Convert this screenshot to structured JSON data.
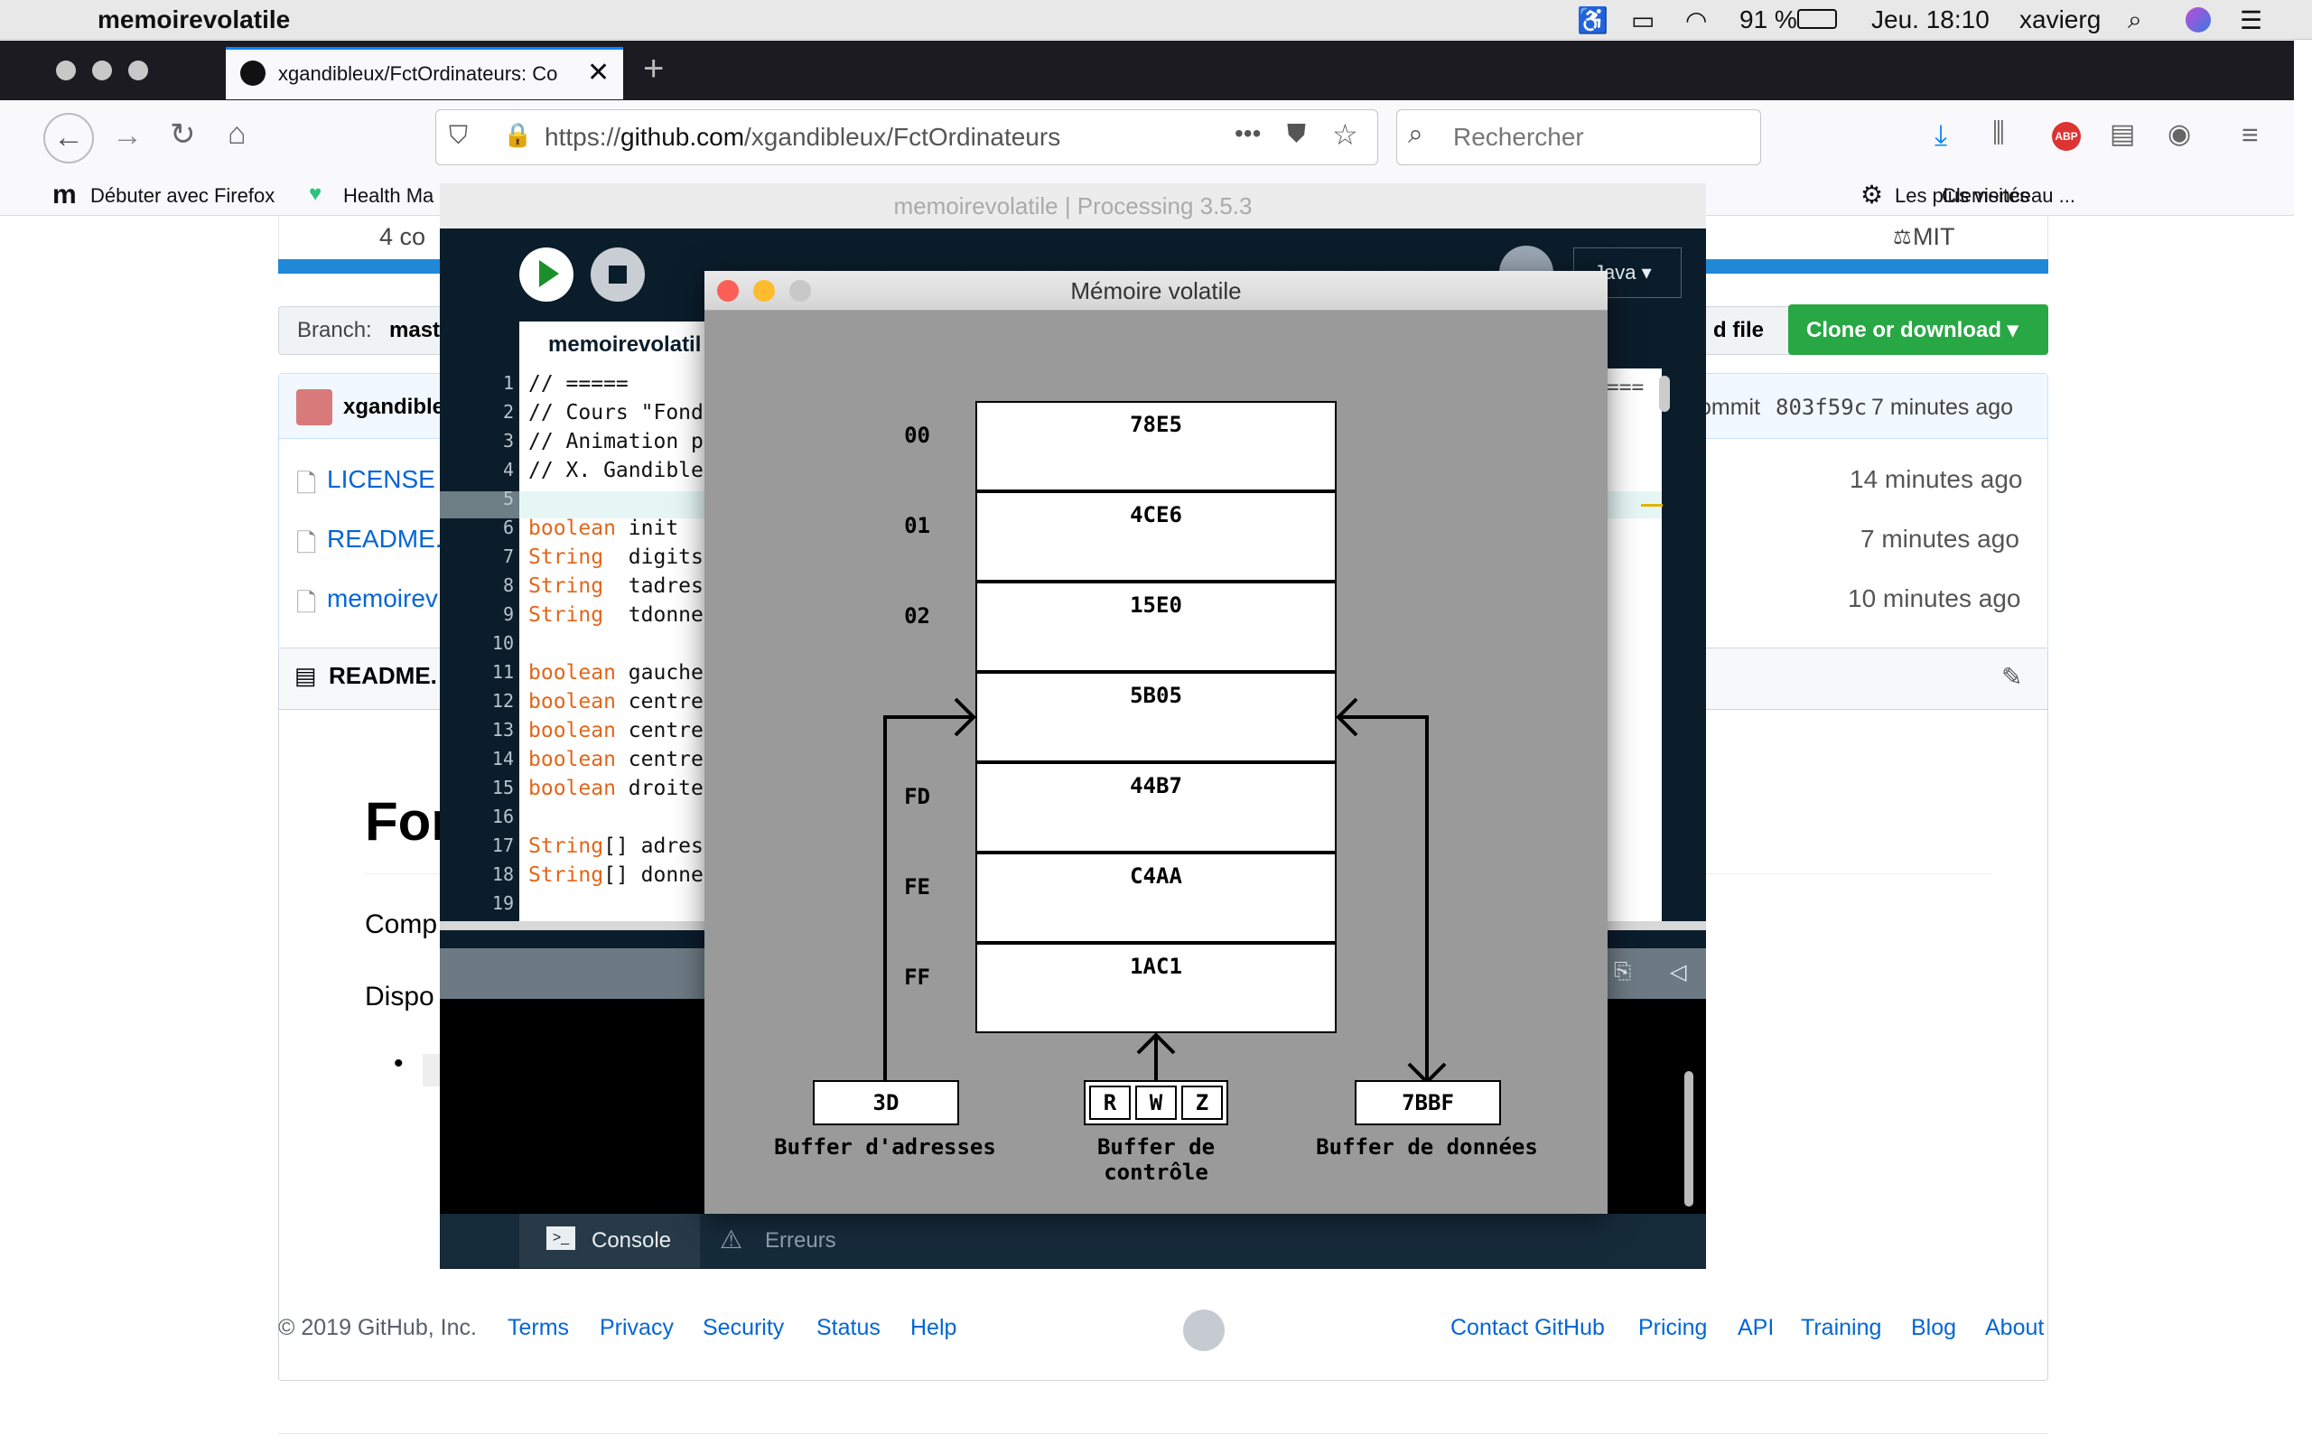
{
  "menubar": {
    "app_name": "memoirevolatile",
    "battery": "91 %",
    "clock": "Jeu. 18:10",
    "user": "xavierg"
  },
  "browser": {
    "tab_title": "xgandibleux/FctOrdinateurs: Co",
    "url_prefix": "https://",
    "url_host": "github.com",
    "url_path": "/xgandibleux/FctOrdinateurs",
    "search_placeholder": "Rechercher",
    "bookmarks": [
      {
        "label": "Débuter avec Firefox"
      },
      {
        "label": "Health Ma"
      },
      {
        "label": "Clemenceau ..."
      },
      {
        "label": "Les plus visités"
      }
    ]
  },
  "github": {
    "commits_partial": "4 co",
    "license_partial": "MIT",
    "branch_label": "Branch:",
    "branch_value": "maste",
    "upload_partial": "d file",
    "clone_button": "Clone or download ▾",
    "author_partial": "xgandible",
    "latest_commit": "ommit",
    "commit_hash": "803f59c",
    "commit_age": "7 minutes ago",
    "files": [
      {
        "name": "LICENSE",
        "age": "14 minutes ago"
      },
      {
        "name": "README.",
        "age": "7 minutes ago"
      },
      {
        "name": "memoirev",
        "age": "10 minutes ago"
      }
    ],
    "readme_header": "README.",
    "readme_title_partial": "For",
    "readme_p1_partial": "Comp",
    "readme_p2_partial": "Dispo",
    "footer": {
      "copyright": "© 2019 GitHub, Inc.",
      "left_links": [
        "Terms",
        "Privacy",
        "Security",
        "Status",
        "Help"
      ],
      "right_links": [
        "Contact GitHub",
        "Pricing",
        "API",
        "Training",
        "Blog",
        "About"
      ]
    }
  },
  "processing": {
    "window_title": "memoirevolatile | Processing 3.5.3",
    "mode": "Java ▾",
    "tab": "memoirevolatil",
    "code_lines": [
      {
        "n": "1",
        "kw": "",
        "text": "// ====="
      },
      {
        "n": "2",
        "kw": "",
        "text": "// Cours \"Fond"
      },
      {
        "n": "3",
        "kw": "",
        "text": "// Animation p"
      },
      {
        "n": "4",
        "kw": "",
        "text": "// X. Gandible"
      },
      {
        "n": "5",
        "kw": "",
        "text": ""
      },
      {
        "n": "6",
        "kw": "boolean",
        "text": " init"
      },
      {
        "n": "7",
        "kw": "String",
        "text": "  digits"
      },
      {
        "n": "8",
        "kw": "String",
        "text": "  tadres"
      },
      {
        "n": "9",
        "kw": "String",
        "text": "  tdonne"
      },
      {
        "n": "10",
        "kw": "",
        "text": ""
      },
      {
        "n": "11",
        "kw": "boolean",
        "text": " gauche"
      },
      {
        "n": "12",
        "kw": "boolean",
        "text": " centre"
      },
      {
        "n": "13",
        "kw": "boolean",
        "text": " centre"
      },
      {
        "n": "14",
        "kw": "boolean",
        "text": " centre"
      },
      {
        "n": "15",
        "kw": "boolean",
        "text": " droite"
      },
      {
        "n": "16",
        "kw": "",
        "text": ""
      },
      {
        "n": "17",
        "kw": "String",
        "text": "[] adres"
      },
      {
        "n": "18",
        "kw": "String",
        "text": "[] donne"
      },
      {
        "n": "19",
        "kw": "",
        "text": ""
      }
    ],
    "right_comment": "====",
    "console_tab": "Console",
    "errors_tab": "Erreurs"
  },
  "sketch": {
    "title": "Mémoire volatile",
    "memory": [
      {
        "addr": "00",
        "value": "78E5"
      },
      {
        "addr": "01",
        "value": "4CE6"
      },
      {
        "addr": "02",
        "value": "15E0"
      },
      {
        "addr": "",
        "value": "5B05"
      },
      {
        "addr": "FD",
        "value": "44B7"
      },
      {
        "addr": "FE",
        "value": "C4AA"
      },
      {
        "addr": "FF",
        "value": "1AC1"
      }
    ],
    "address_buffer": {
      "value": "3D",
      "label": "Buffer d'adresses"
    },
    "control_buffer": {
      "bits": [
        "R",
        "W",
        "Z"
      ],
      "label": "Buffer de contrôle"
    },
    "data_buffer": {
      "value": "7BBF",
      "label": "Buffer de données"
    }
  }
}
